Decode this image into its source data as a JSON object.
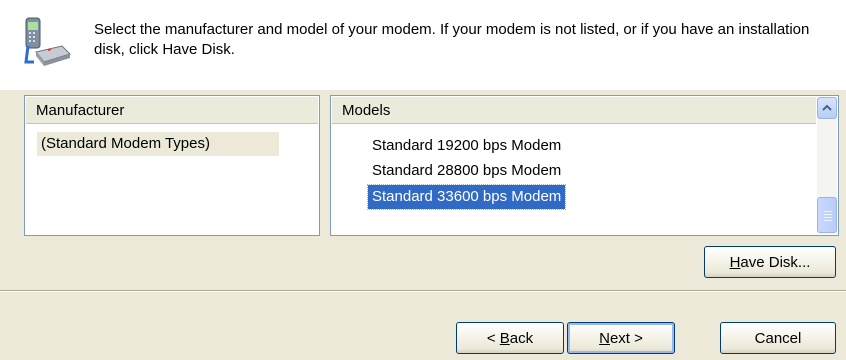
{
  "header": {
    "text": "Select the manufacturer and model of your modem. If your modem is not listed, or if you have an installation disk, click Have Disk.",
    "icon": "modem-phone-icon"
  },
  "manufacturer_list": {
    "column_header": "Manufacturer",
    "items": [
      "(Standard Modem Types)"
    ],
    "selected": "(Standard Modem Types)"
  },
  "models_list": {
    "column_header": "Models",
    "items": [
      "Standard 19200 bps Modem",
      "Standard 28800 bps Modem",
      "Standard 33600 bps Modem"
    ],
    "selected": "Standard 33600 bps Modem"
  },
  "buttons": {
    "have_disk": {
      "mnemonic": "H",
      "rest": "ave Disk..."
    },
    "back": {
      "prefix": "< ",
      "mnemonic": "B",
      "rest": "ack"
    },
    "next": {
      "mnemonic": "N",
      "rest": "ext >"
    },
    "cancel": "Cancel"
  },
  "colors": {
    "selection": "#316ac5",
    "dialog_background": "#ece9d8",
    "button_border": "#003c74"
  }
}
